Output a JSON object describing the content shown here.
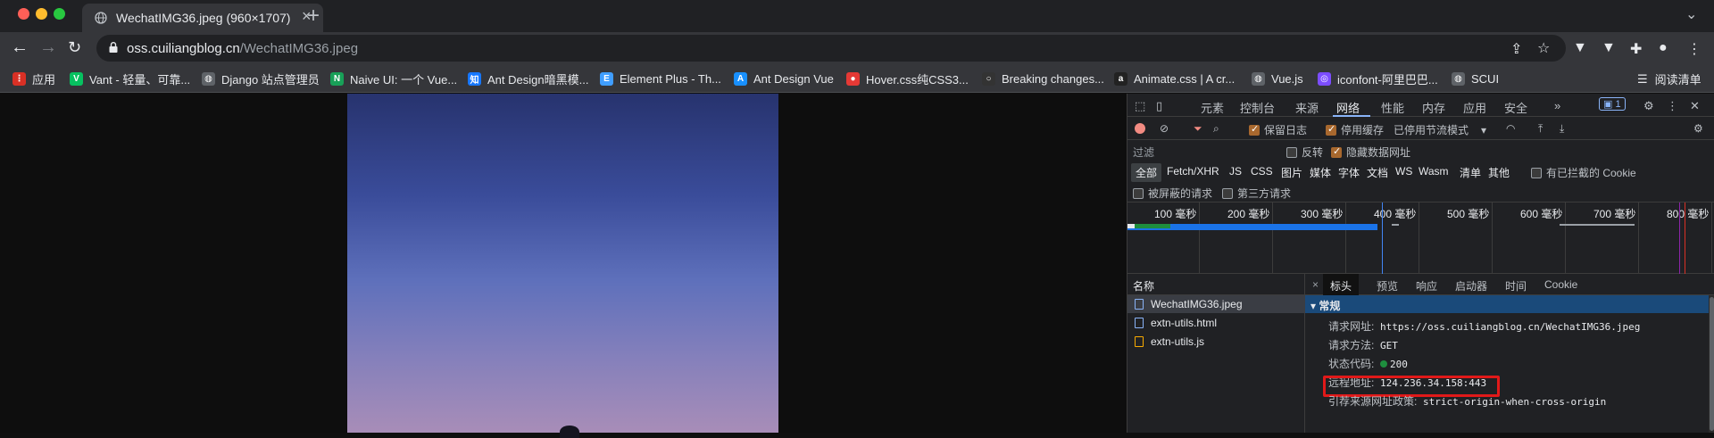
{
  "tab": {
    "title": "WechatIMG36.jpeg (960×1707)",
    "new_tab": "+",
    "close": "×"
  },
  "omnibox": {
    "host": "oss.cuiliangblog.cn",
    "path": "/WechatIMG36.jpeg"
  },
  "bookmarks": [
    {
      "label": "应用",
      "color": "#d93025",
      "glyph": "⋮"
    },
    {
      "label": "Vant - 轻量、可靠...",
      "color": "#07c160",
      "glyph": "V"
    },
    {
      "label": "Django 站点管理员",
      "color": "#5f6368",
      "glyph": "◍"
    },
    {
      "label": "Naive UI: 一个 Vue...",
      "color": "#18a058",
      "glyph": "N"
    },
    {
      "label": "Ant Design暗黑模...",
      "color": "#1677ff",
      "glyph": "知"
    },
    {
      "label": "Element Plus - Th...",
      "color": "#409eff",
      "glyph": "E"
    },
    {
      "label": "Ant Design Vue",
      "color": "#1890ff",
      "glyph": "A"
    },
    {
      "label": "Hover.css纯CSS3...",
      "color": "#e53935",
      "glyph": "●"
    },
    {
      "label": "Breaking changes...",
      "color": "#333",
      "glyph": "○"
    },
    {
      "label": "Animate.css | A cr...",
      "color": "#222",
      "glyph": "a"
    },
    {
      "label": "Vue.js",
      "color": "#5f6368",
      "glyph": "◍"
    },
    {
      "label": "iconfont-阿里巴巴...",
      "color": "#7c4dff",
      "glyph": "◎"
    },
    {
      "label": "SCUI",
      "color": "#5f6368",
      "glyph": "◍"
    }
  ],
  "reading_list": "阅读清单",
  "devtools": {
    "tabs": [
      "元素",
      "控制台",
      "来源",
      "网络",
      "性能",
      "内存",
      "应用",
      "安全"
    ],
    "more": "»",
    "issues_badge": "1",
    "controls": {
      "preserve_log": "保留日志",
      "disable_cache": "停用缓存",
      "throttle": "已停用节流模式"
    },
    "filter": {
      "placeholder": "过滤",
      "invert": "反转",
      "hide_data_urls": "隐藏数据网址"
    },
    "types": [
      "全部",
      "Fetch/XHR",
      "JS",
      "CSS",
      "图片",
      "媒体",
      "字体",
      "文档",
      "WS",
      "Wasm",
      "清单",
      "其他"
    ],
    "blocked_cookies": "有已拦截的 Cookie",
    "blocked_requests": "被屏蔽的请求",
    "third_party": "第三方请求",
    "ticks": [
      "100 毫秒",
      "200 毫秒",
      "300 毫秒",
      "400 毫秒",
      "500 毫秒",
      "600 毫秒",
      "700 毫秒",
      "800 毫秒"
    ],
    "name_header": "名称",
    "requests": [
      {
        "name": "WechatIMG36.jpeg",
        "color": "#8ab4f8"
      },
      {
        "name": "extn-utils.html",
        "color": "#8ab4f8"
      },
      {
        "name": "extn-utils.js",
        "color": "#f9ab00"
      }
    ],
    "detail_close": "×",
    "detail_tabs": [
      "标头",
      "预览",
      "响应",
      "启动器",
      "时间",
      "Cookie"
    ],
    "section": "▾ 常规",
    "general": {
      "request_url_key": "请求网址:",
      "request_url": "https://oss.cuiliangblog.cn/WechatIMG36.jpeg",
      "method_key": "请求方法:",
      "method": "GET",
      "status_key": "状态代码:",
      "status": "200",
      "remote_key": "远程地址:",
      "remote": "124.236.34.158:443",
      "referrer_key": "引荐来源网址政策:",
      "referrer": "strict-origin-when-cross-origin"
    }
  }
}
